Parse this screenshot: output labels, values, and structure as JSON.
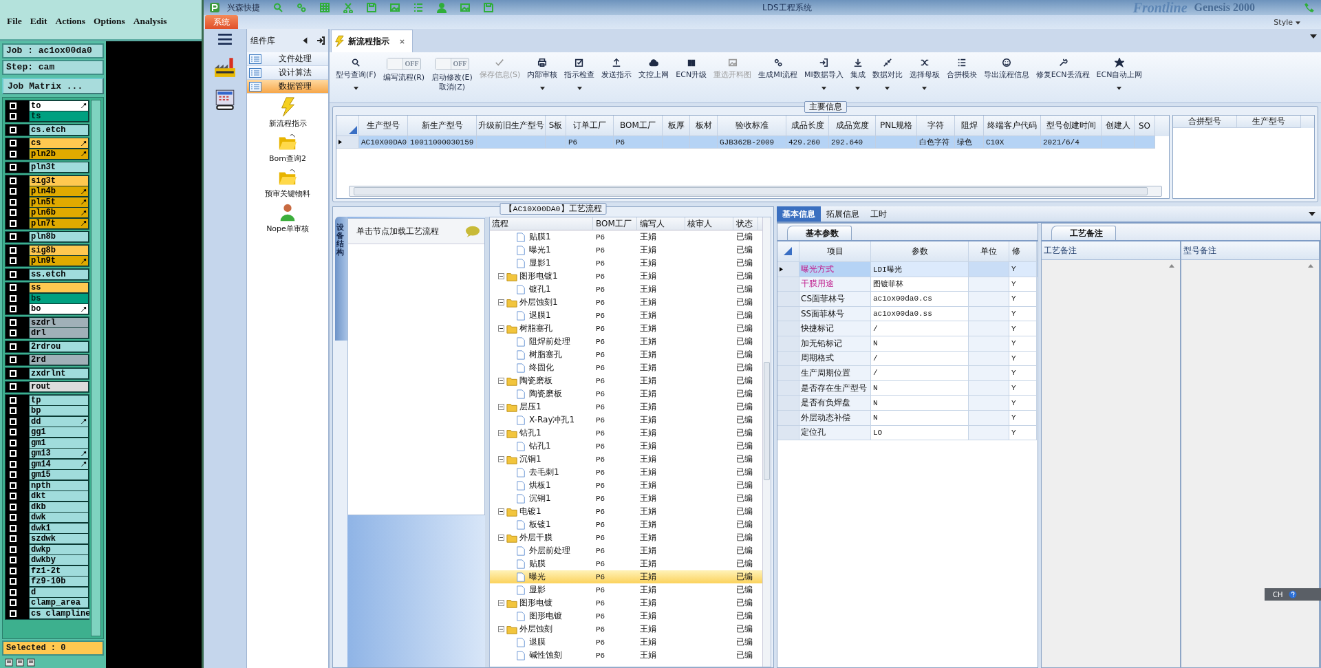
{
  "genesis": {
    "menu": [
      "File",
      "Edit",
      "Actions",
      "Options",
      "Analysis"
    ],
    "job": "Job : ac1ox00da0",
    "step": "Step: cam",
    "matrix_button": "Job Matrix ...",
    "layer_groups": [
      {
        "layers": [
          {
            "name": "to",
            "color": "#ffffff",
            "marked": true,
            "checked": false
          },
          {
            "name": "ts",
            "color": "#00a080",
            "marked": false,
            "checked": false
          }
        ]
      },
      {
        "layers": [
          {
            "name": "cs.etch",
            "color": "#a0dcdc",
            "marked": false,
            "checked": false
          }
        ]
      },
      {
        "layers": [
          {
            "name": "cs",
            "color": "#ffc850",
            "marked": true,
            "checked": false
          },
          {
            "name": "pln2b",
            "color": "#e0aa00",
            "marked": true,
            "checked": false
          }
        ]
      },
      {
        "layers": [
          {
            "name": "pln3t",
            "color": "#a0dcdc",
            "marked": false,
            "checked": false
          }
        ]
      },
      {
        "layers": [
          {
            "name": "sig3t",
            "color": "#ffc850",
            "marked": false,
            "checked": false
          },
          {
            "name": "pln4b",
            "color": "#e0aa00",
            "marked": true,
            "checked": false
          },
          {
            "name": "pln5t",
            "color": "#e0aa00",
            "marked": true,
            "checked": false
          },
          {
            "name": "pln6b",
            "color": "#e0aa00",
            "marked": true,
            "checked": false
          },
          {
            "name": "pln7t",
            "color": "#e0aa00",
            "marked": true,
            "checked": false
          }
        ]
      },
      {
        "layers": [
          {
            "name": "pln8b",
            "color": "#a0dcdc",
            "marked": false,
            "checked": false
          }
        ]
      },
      {
        "layers": [
          {
            "name": "sig8b",
            "color": "#ffc850",
            "marked": false,
            "checked": false
          },
          {
            "name": "pln9t",
            "color": "#e0aa00",
            "marked": true,
            "checked": false
          }
        ]
      },
      {
        "layers": [
          {
            "name": "ss.etch",
            "color": "#a0dcdc",
            "marked": false,
            "checked": false
          }
        ]
      },
      {
        "layers": [
          {
            "name": "ss",
            "color": "#ffc850",
            "marked": false,
            "checked": false
          },
          {
            "name": "bs",
            "color": "#00a080",
            "marked": false,
            "checked": false
          },
          {
            "name": "bo",
            "color": "#ffffff",
            "marked": true,
            "checked": false
          }
        ]
      },
      {
        "layers": [
          {
            "name": "szdrl",
            "color": "#a0b0b8",
            "marked": false,
            "checked": false
          },
          {
            "name": "drl",
            "color": "#a0b0b8",
            "marked": false,
            "checked": false
          }
        ]
      },
      {
        "layers": [
          {
            "name": "2rdrou",
            "color": "#a0dcdc",
            "marked": false,
            "checked": false
          }
        ]
      },
      {
        "layers": [
          {
            "name": "2rd",
            "color": "#a0b0b8",
            "marked": false,
            "checked": false
          }
        ]
      },
      {
        "layers": [
          {
            "name": "zxdrlnt",
            "color": "#a0dcdc",
            "marked": false,
            "checked": false
          }
        ]
      },
      {
        "layers": [
          {
            "name": "rout",
            "color": "#dcdcdc",
            "marked": false,
            "checked": false
          }
        ]
      },
      {
        "layers": [
          {
            "name": "tp",
            "color": "#a0dcdc",
            "marked": false,
            "checked": false
          },
          {
            "name": "bp",
            "color": "#a0dcdc",
            "marked": false,
            "checked": false
          },
          {
            "name": "dd",
            "color": "#a0dcdc",
            "marked": true,
            "checked": false
          },
          {
            "name": "gg1",
            "color": "#a0dcdc",
            "marked": false,
            "checked": false
          },
          {
            "name": "gm1",
            "color": "#a0dcdc",
            "marked": false,
            "checked": false
          },
          {
            "name": "gm13",
            "color": "#a0dcdc",
            "marked": true,
            "checked": false
          },
          {
            "name": "gm14",
            "color": "#a0dcdc",
            "marked": true,
            "checked": false
          },
          {
            "name": "gm15",
            "color": "#a0dcdc",
            "marked": false,
            "checked": false
          },
          {
            "name": "npth",
            "color": "#a0dcdc",
            "marked": false,
            "checked": false
          },
          {
            "name": "dkt",
            "color": "#a0dcdc",
            "marked": false,
            "checked": false
          },
          {
            "name": "dkb",
            "color": "#a0dcdc",
            "marked": false,
            "checked": false
          },
          {
            "name": "dwk",
            "color": "#a0dcdc",
            "marked": false,
            "checked": false
          },
          {
            "name": "dwk1",
            "color": "#a0dcdc",
            "marked": false,
            "checked": false
          },
          {
            "name": "szdwk",
            "color": "#a0dcdc",
            "marked": false,
            "checked": false
          },
          {
            "name": "dwkp",
            "color": "#a0dcdc",
            "marked": false,
            "checked": false
          },
          {
            "name": "dwkby",
            "color": "#a0dcdc",
            "marked": false,
            "checked": false
          },
          {
            "name": "fz1-2t",
            "color": "#a0dcdc",
            "marked": false,
            "checked": false
          },
          {
            "name": "fz9-10b",
            "color": "#a0dcdc",
            "marked": false,
            "checked": false
          },
          {
            "name": "d",
            "color": "#a0dcdc",
            "marked": false,
            "checked": false
          },
          {
            "name": "clamp_area",
            "color": "#a0dcdc",
            "marked": false,
            "checked": false
          },
          {
            "name": "cs clampline",
            "color": "#a0dcdc",
            "marked": false,
            "checked": false
          }
        ]
      }
    ],
    "selected": "Selected : 0"
  },
  "app": {
    "name": "兴森快捷",
    "title": "LDS工程系统",
    "menu_tab": "系统",
    "brand": [
      "Frontline",
      "Genesis 2000"
    ],
    "style_label": "Style"
  },
  "sidebar": {
    "title": "组件库",
    "categories": [
      {
        "label": "文件处理",
        "selected": false
      },
      {
        "label": "设计算法",
        "selected": false
      },
      {
        "label": "数据管理",
        "selected": true
      }
    ],
    "tools": [
      {
        "label": "新流程指示"
      },
      {
        "label": "Bom查询2"
      },
      {
        "label": "预审关键物料"
      },
      {
        "label": "Nope单审核"
      }
    ]
  },
  "doc_tabs": [
    {
      "label": "新流程指示",
      "selected": true
    }
  ],
  "toolbar": [
    {
      "kind": "button",
      "label": "型号查询(F)",
      "disabled": false,
      "menu": true
    },
    {
      "kind": "toggle",
      "label": "编写流程(R)",
      "state_text": "OFF",
      "on": false
    },
    {
      "kind": "toggle",
      "label": "启动修改(E)\n取消(Z)",
      "state_text": "OFF",
      "on": false
    },
    {
      "kind": "button",
      "label": "保存信息(S)",
      "disabled": true,
      "menu": false
    },
    {
      "kind": "button",
      "label": "内部审核",
      "disabled": false,
      "menu": true
    },
    {
      "kind": "button",
      "label": "指示检查",
      "disabled": false,
      "menu": true
    },
    {
      "kind": "button",
      "label": "发送指示",
      "disabled": false,
      "menu": false
    },
    {
      "kind": "button",
      "label": "文控上网",
      "disabled": false,
      "menu": false
    },
    {
      "kind": "button",
      "label": "ECN升级",
      "disabled": false,
      "menu": false
    },
    {
      "kind": "button",
      "label": "重选开料图",
      "disabled": true,
      "menu": false
    },
    {
      "kind": "button",
      "label": "生成MI流程",
      "disabled": false,
      "menu": false
    },
    {
      "kind": "button",
      "label": "MI数据导入",
      "disabled": false,
      "menu": true
    },
    {
      "kind": "button",
      "label": "集成",
      "disabled": false,
      "menu": true
    },
    {
      "kind": "button",
      "label": "数据对比",
      "disabled": false,
      "menu": true
    },
    {
      "kind": "button",
      "label": "选择母板",
      "disabled": false,
      "menu": true
    },
    {
      "kind": "button",
      "label": "合拼模块",
      "disabled": false,
      "menu": false
    },
    {
      "kind": "button",
      "label": "导出流程信息",
      "disabled": false,
      "menu": false
    },
    {
      "kind": "button",
      "label": "修复ECN丢流程",
      "disabled": false,
      "menu": false
    },
    {
      "kind": "button",
      "label": "ECN自动上网",
      "disabled": false,
      "menu": true
    }
  ],
  "main_info": {
    "title": "主要信息",
    "columns": [
      "生产型号",
      "新生产型号",
      "升级前旧生产型号",
      "S板",
      "订单工厂",
      "BOM工厂",
      "板厚",
      "板材",
      "验收标准",
      "成品长度",
      "成品宽度",
      "PNL规格",
      "字符",
      "阻焊",
      "终端客户代码",
      "型号创建时间",
      "创建人",
      "SO"
    ],
    "rows": [
      {
        "selected": true,
        "cells": [
          "AC10X00DA0",
          "10011000030159",
          null,
          null,
          "P6",
          "P6",
          null,
          null,
          "GJB362B-2009",
          "429.260",
          "292.640",
          null,
          "白色字符",
          "绿色",
          "C10X",
          "2021/6/4",
          null,
          null
        ]
      }
    ],
    "side_columns": [
      "合拼型号",
      "生产型号"
    ]
  },
  "flow": {
    "title": "【AC10X00DA0】工艺流程",
    "side_tab": "设备结构",
    "hint": "单击节点加载工艺流程",
    "columns": [
      "流程",
      "BOM工厂",
      "编写人",
      "核审人",
      "状态"
    ],
    "nodes": [
      {
        "children": [
          {
            "name": "贴膜1",
            "bom": "P6",
            "writer": "王娟",
            "status": "已编",
            "selected": false
          },
          {
            "name": "曝光1",
            "bom": "P6",
            "writer": "王娟",
            "status": "已编",
            "selected": false
          },
          {
            "name": "显影1",
            "bom": "P6",
            "writer": "王娟",
            "status": "已编",
            "selected": false
          }
        ]
      },
      {
        "name": "图形电镀1",
        "bom": "P6",
        "writer": "王娟",
        "status": "已编",
        "selected": false,
        "expanded": true,
        "children": [
          {
            "name": "镀孔1",
            "bom": "P6",
            "writer": "王娟",
            "status": "已编",
            "selected": false
          }
        ]
      },
      {
        "name": "外层蚀刻1",
        "bom": "P6",
        "writer": "王娟",
        "status": "已编",
        "selected": false,
        "expanded": true,
        "children": [
          {
            "name": "退膜1",
            "bom": "P6",
            "writer": "王娟",
            "status": "已编",
            "selected": false
          }
        ]
      },
      {
        "name": "树脂塞孔",
        "bom": "P6",
        "writer": "王娟",
        "status": "已编",
        "selected": false,
        "expanded": true,
        "children": [
          {
            "name": "阻焊前处理",
            "bom": "P6",
            "writer": "王娟",
            "status": "已编",
            "selected": false
          },
          {
            "name": "树脂塞孔",
            "bom": "P6",
            "writer": "王娟",
            "status": "已编",
            "selected": false
          },
          {
            "name": "终固化",
            "bom": "P6",
            "writer": "王娟",
            "status": "已编",
            "selected": false
          }
        ]
      },
      {
        "name": "陶瓷磨板",
        "bom": "P6",
        "writer": "王娟",
        "status": "已编",
        "selected": false,
        "expanded": true,
        "children": [
          {
            "name": "陶瓷磨板",
            "bom": "P6",
            "writer": "王娟",
            "status": "已编",
            "selected": false
          }
        ]
      },
      {
        "name": "层压1",
        "bom": "P6",
        "writer": "王娟",
        "status": "已编",
        "selected": false,
        "expanded": true,
        "children": [
          {
            "name": "X-Ray冲孔1",
            "bom": "P6",
            "writer": "王娟",
            "status": "已编",
            "selected": false
          }
        ]
      },
      {
        "name": "钻孔1",
        "bom": "P6",
        "writer": "王娟",
        "status": "已编",
        "selected": false,
        "expanded": true,
        "children": [
          {
            "name": "钻孔1",
            "bom": "P6",
            "writer": "王娟",
            "status": "已编",
            "selected": false
          }
        ]
      },
      {
        "name": "沉铜1",
        "bom": "P6",
        "writer": "王娟",
        "status": "已编",
        "selected": false,
        "expanded": true,
        "children": [
          {
            "name": "去毛刺1",
            "bom": "P6",
            "writer": "王娟",
            "status": "已编",
            "selected": false
          },
          {
            "name": "烘板1",
            "bom": "P6",
            "writer": "王娟",
            "status": "已编",
            "selected": false
          },
          {
            "name": "沉铜1",
            "bom": "P6",
            "writer": "王娟",
            "status": "已编",
            "selected": false
          }
        ]
      },
      {
        "name": "电镀1",
        "bom": "P6",
        "writer": "王娟",
        "status": "已编",
        "selected": false,
        "expanded": true,
        "children": [
          {
            "name": "板镀1",
            "bom": "P6",
            "writer": "王娟",
            "status": "已编",
            "selected": false
          }
        ]
      },
      {
        "name": "外层干膜",
        "bom": "P6",
        "writer": "王娟",
        "status": "已编",
        "selected": false,
        "expanded": true,
        "children": [
          {
            "name": "外层前处理",
            "bom": "P6",
            "writer": "王娟",
            "status": "已编",
            "selected": false
          },
          {
            "name": "贴膜",
            "bom": "P6",
            "writer": "王娟",
            "status": "已编",
            "selected": false
          },
          {
            "name": "曝光",
            "bom": "P6",
            "writer": "王娟",
            "status": "已编",
            "selected": true
          },
          {
            "name": "显影",
            "bom": "P6",
            "writer": "王娟",
            "status": "已编",
            "selected": false
          }
        ]
      },
      {
        "name": "图形电镀",
        "bom": "P6",
        "writer": "王娟",
        "status": "已编",
        "selected": false,
        "expanded": true,
        "children": [
          {
            "name": "图形电镀",
            "bom": "P6",
            "writer": "王娟",
            "status": "已编",
            "selected": false
          }
        ]
      },
      {
        "name": "外层蚀刻",
        "bom": "P6",
        "writer": "王娟",
        "status": "已编",
        "selected": false,
        "expanded": true,
        "children": [
          {
            "name": "退膜",
            "bom": "P6",
            "writer": "王娟",
            "status": "已编",
            "selected": false
          },
          {
            "name": "碱性蚀刻",
            "bom": "P6",
            "writer": "王娟",
            "status": "已编",
            "selected": false
          }
        ]
      }
    ]
  },
  "details": {
    "tabs": [
      {
        "label": "基本信息",
        "selected": true
      },
      {
        "label": "拓展信息",
        "selected": false
      },
      {
        "label": "工时",
        "selected": false
      }
    ],
    "params": {
      "tab": "基本参数",
      "columns": [
        "项目",
        "参数",
        "单位",
        "修"
      ],
      "rows": [
        {
          "item": "曝光方式",
          "value": "LDI曝光",
          "flag": "Y",
          "required": true,
          "selected": true
        },
        {
          "item": "干膜用途",
          "value": "图镀菲林",
          "flag": "Y",
          "required": true,
          "selected": false
        },
        {
          "item": "CS面菲林号",
          "value": "ac1ox00da0.cs",
          "flag": "Y",
          "required": false,
          "selected": false
        },
        {
          "item": "SS面菲林号",
          "value": "ac1ox00da0.ss",
          "flag": "Y",
          "required": false,
          "selected": false
        },
        {
          "item": "快捷标记",
          "value": "/",
          "flag": "Y",
          "required": false,
          "selected": false
        },
        {
          "item": "加无铅标记",
          "value": "N",
          "flag": "Y",
          "required": false,
          "selected": false
        },
        {
          "item": "周期格式",
          "value": "/",
          "flag": "Y",
          "required": false,
          "selected": false
        },
        {
          "item": "生产周期位置",
          "value": "/",
          "flag": "Y",
          "required": false,
          "selected": false
        },
        {
          "item": "是否存在生产型号",
          "value": "N",
          "flag": "Y",
          "required": false,
          "selected": false
        },
        {
          "item": "是否有负焊盘",
          "value": "N",
          "flag": "Y",
          "required": false,
          "selected": false
        },
        {
          "item": "外层动态补偿",
          "value": "N",
          "flag": "Y",
          "required": false,
          "selected": false
        },
        {
          "item": "定位孔",
          "value": "LO",
          "flag": "Y",
          "required": false,
          "selected": false
        }
      ]
    },
    "notes": {
      "tab": "工艺备注",
      "columns": [
        "工艺备注",
        "型号备注"
      ]
    }
  },
  "ime": "CH"
}
